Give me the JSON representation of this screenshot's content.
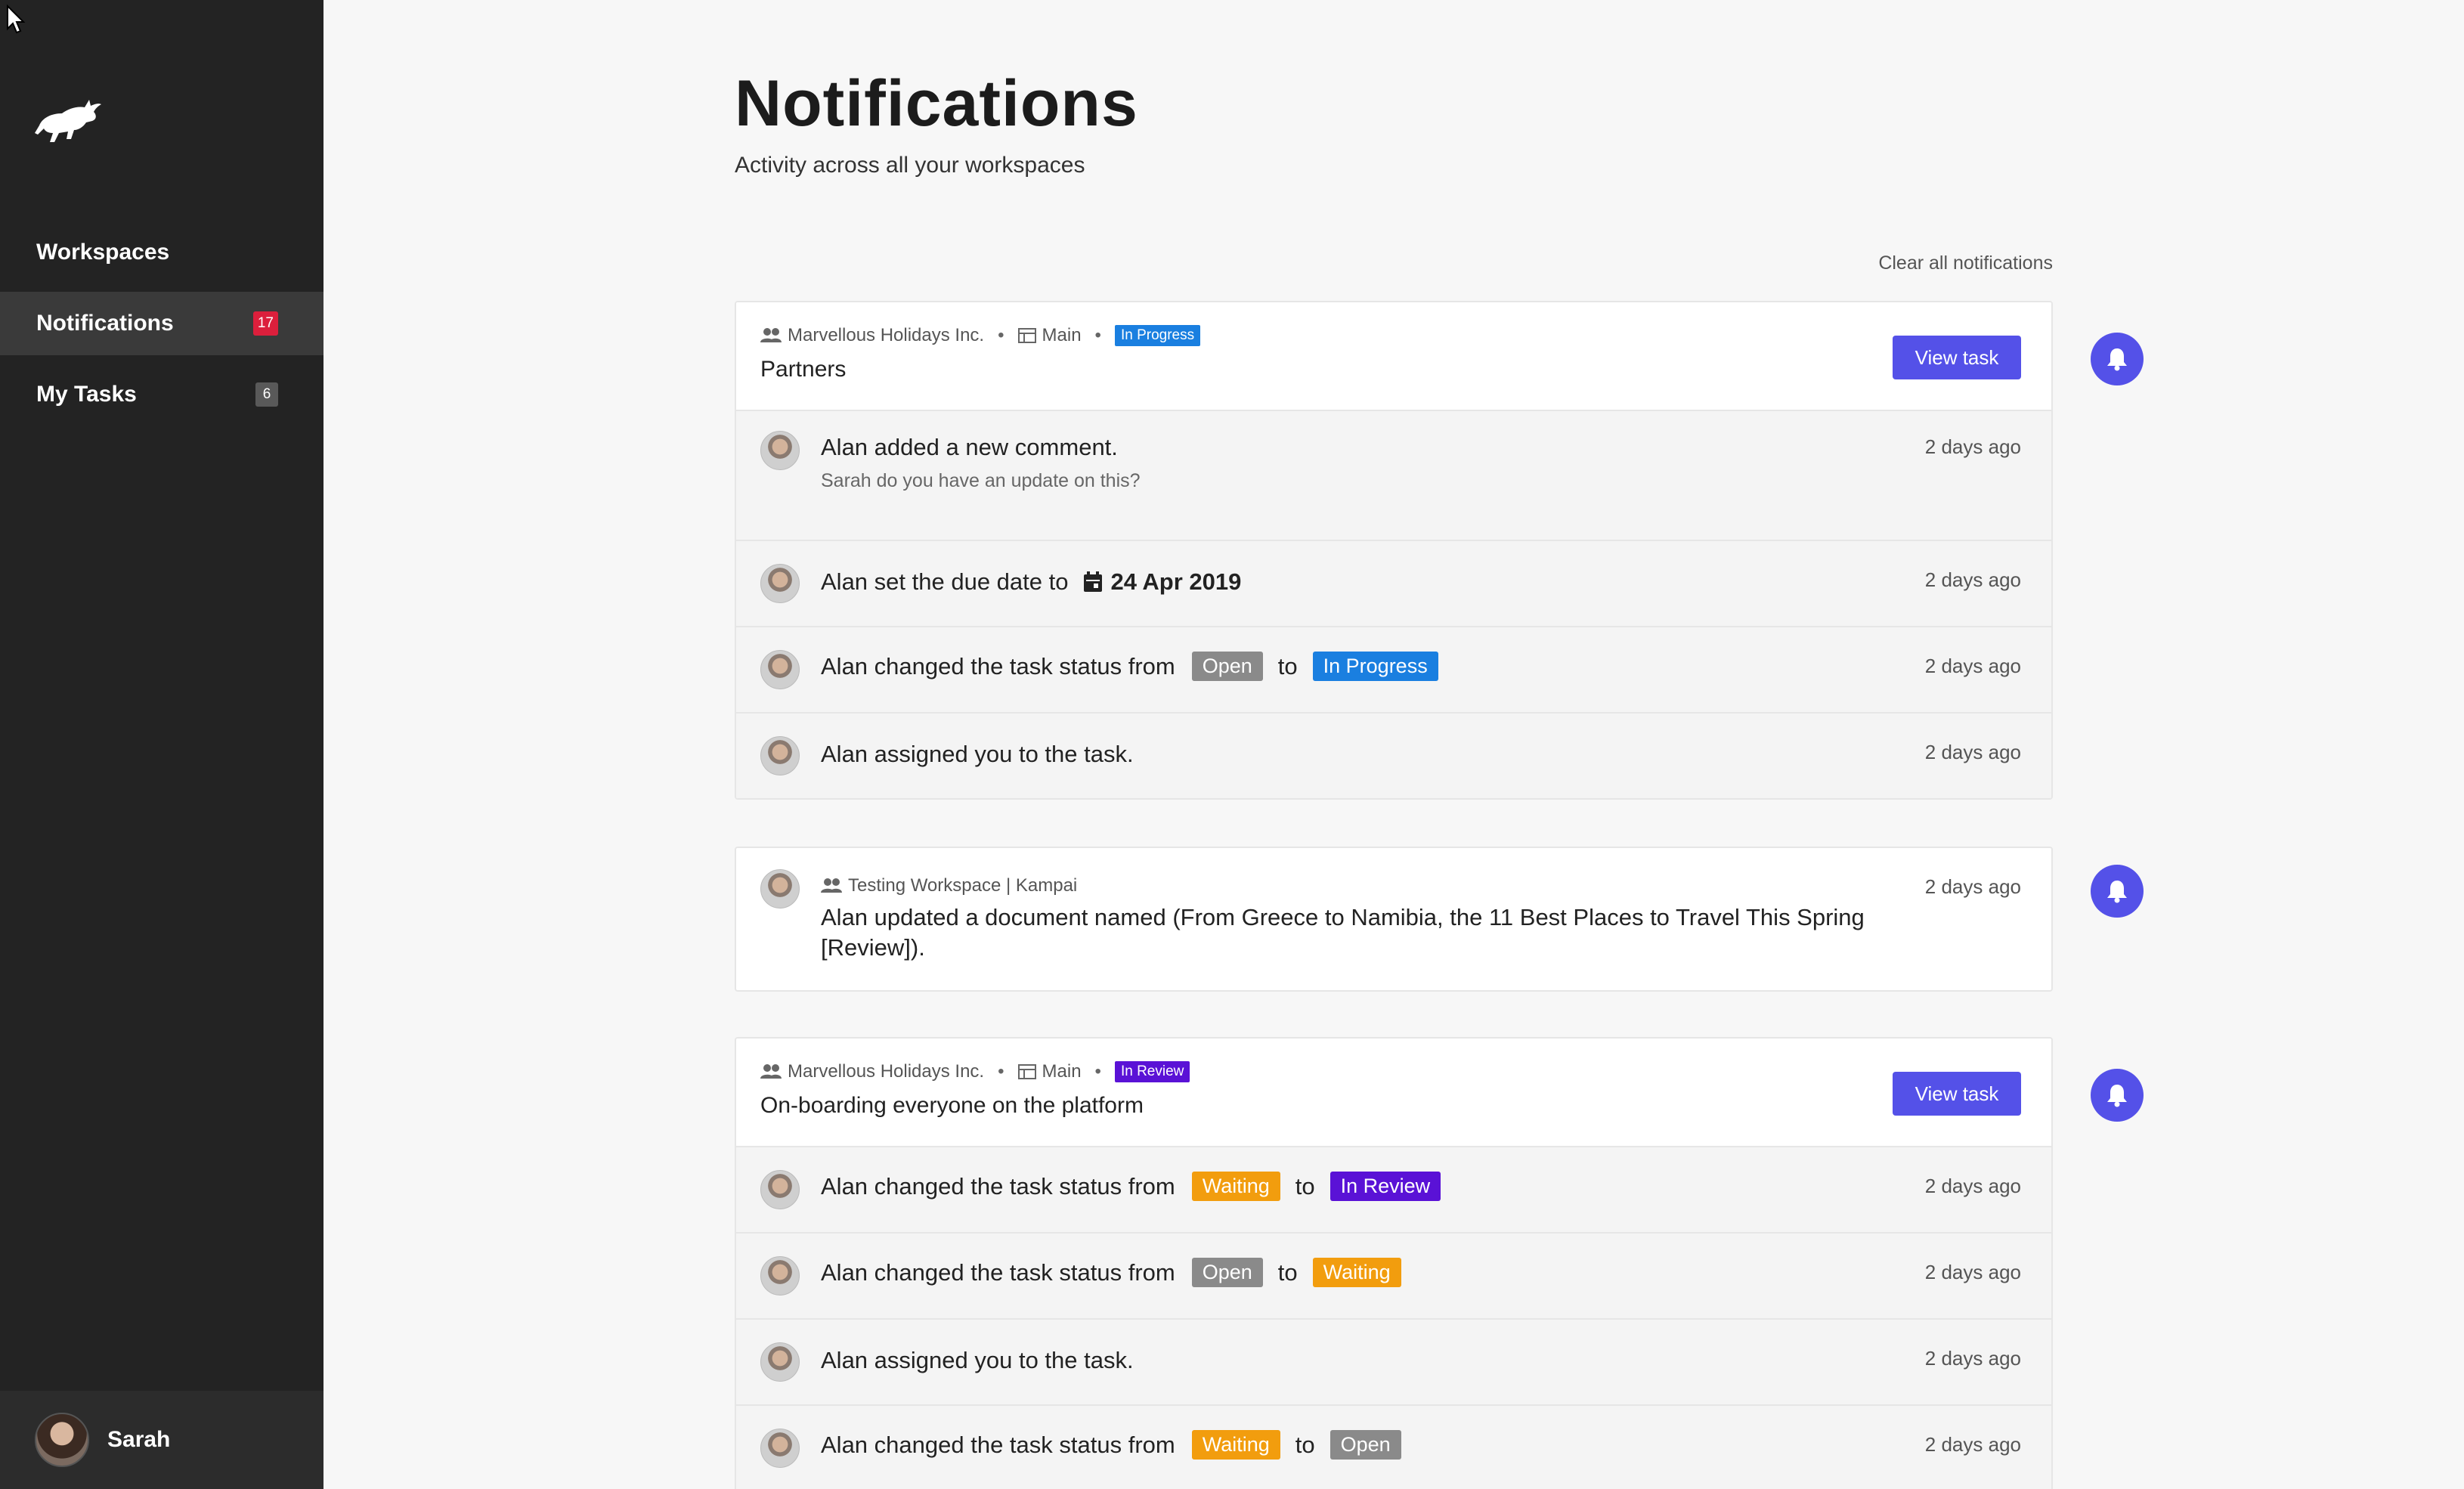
{
  "sidebar": {
    "logo": "bull-logo-icon",
    "items": [
      {
        "label": "Workspaces",
        "badge": null
      },
      {
        "label": "Notifications",
        "badge": "17",
        "active": true
      },
      {
        "label": "My Tasks",
        "badge": "6"
      }
    ],
    "user": {
      "name": "Sarah"
    }
  },
  "header": {
    "title": "Notifications",
    "subtitle": "Activity across all your workspaces",
    "clear_all": "Clear all notifications"
  },
  "colors": {
    "accent": "#5451e8",
    "in_progress": "#1a7fe0",
    "in_review": "#5a12d6",
    "open": "#8a8a8a",
    "waiting": "#f29d0e",
    "badge_red": "#dc1f3c"
  },
  "cards": [
    {
      "workspace": "Marvellous Holidays Inc.",
      "board": "Main",
      "status": "In Progress",
      "title": "Partners",
      "button": "View task",
      "rows": [
        {
          "text": "Alan added a new comment.",
          "sub": "Sarah do you have an update on this?",
          "time": "2 days ago"
        },
        {
          "text": "Alan set the due date to",
          "date": "24 Apr 2019",
          "time": "2 days ago"
        },
        {
          "text": "Alan changed the task status from",
          "from": "Open",
          "to_word": "to",
          "to": "In Progress",
          "time": "2 days ago"
        },
        {
          "text": "Alan assigned you to the task.",
          "time": "2 days ago"
        }
      ]
    },
    {
      "workspace": "Testing Workspace | Kampai",
      "text_line1": "Alan updated a document named (From Greece to Namibia, the 11 Best Places to Travel This Spring",
      "text_line2": "[Review]).",
      "time": "2 days ago"
    },
    {
      "workspace": "Marvellous Holidays Inc.",
      "board": "Main",
      "status": "In Review",
      "title": "On-boarding everyone on the platform",
      "button": "View task",
      "rows": [
        {
          "text": "Alan changed the task status from",
          "from": "Waiting",
          "to_word": "to",
          "to": "In Review",
          "time": "2 days ago"
        },
        {
          "text": "Alan changed the task status from",
          "from": "Open",
          "to_word": "to",
          "to": "Waiting",
          "time": "2 days ago"
        },
        {
          "text": "Alan assigned you to the task.",
          "time": "2 days ago"
        },
        {
          "text": "Alan changed the task status from",
          "from": "Waiting",
          "to_word": "to",
          "to": "Open",
          "time": "2 days ago"
        }
      ]
    }
  ]
}
